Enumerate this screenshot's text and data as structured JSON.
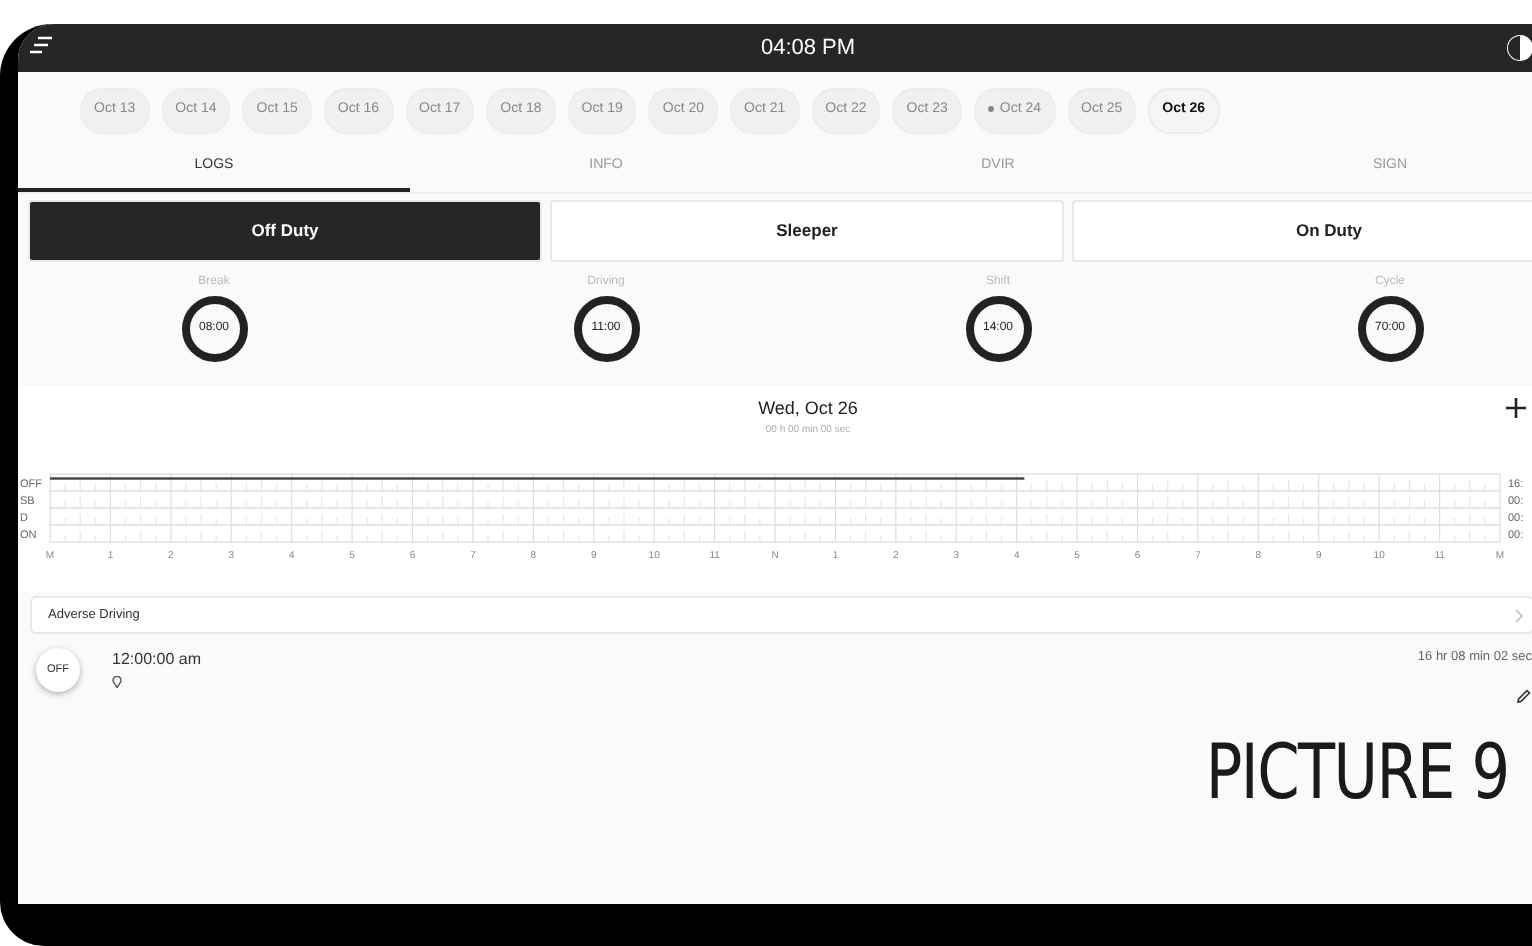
{
  "status_bar": {
    "time": "04:08 PM"
  },
  "dates": [
    {
      "label": "Oct 13",
      "selected": false,
      "dot": false
    },
    {
      "label": "Oct 14",
      "selected": false,
      "dot": false
    },
    {
      "label": "Oct 15",
      "selected": false,
      "dot": false
    },
    {
      "label": "Oct 16",
      "selected": false,
      "dot": false
    },
    {
      "label": "Oct 17",
      "selected": false,
      "dot": false
    },
    {
      "label": "Oct 18",
      "selected": false,
      "dot": false
    },
    {
      "label": "Oct 19",
      "selected": false,
      "dot": false
    },
    {
      "label": "Oct 20",
      "selected": false,
      "dot": false
    },
    {
      "label": "Oct 21",
      "selected": false,
      "dot": false
    },
    {
      "label": "Oct 22",
      "selected": false,
      "dot": false
    },
    {
      "label": "Oct 23",
      "selected": false,
      "dot": false
    },
    {
      "label": "Oct 24",
      "selected": false,
      "dot": true
    },
    {
      "label": "Oct 25",
      "selected": false,
      "dot": false
    },
    {
      "label": "Oct 26",
      "selected": true,
      "dot": false
    }
  ],
  "tabs": [
    {
      "label": "LOGS",
      "selected": true
    },
    {
      "label": "INFO",
      "selected": false
    },
    {
      "label": "DVIR",
      "selected": false
    },
    {
      "label": "SIGN",
      "selected": false
    }
  ],
  "duty_buttons": [
    {
      "label": "Off Duty",
      "selected": true
    },
    {
      "label": "Sleeper",
      "selected": false
    },
    {
      "label": "On Duty",
      "selected": false
    }
  ],
  "gauges": [
    {
      "label": "Break",
      "value": "08:00"
    },
    {
      "label": "Driving",
      "value": "11:00"
    },
    {
      "label": "Shift",
      "value": "14:00"
    },
    {
      "label": "Cycle",
      "value": "70:00"
    }
  ],
  "log_chart": {
    "title": "Wed, Oct 26",
    "subtitle": "00 h 00 min 00 sec",
    "rows": [
      {
        "label": "OFF",
        "total": "16:",
        "level": 0.672
      },
      {
        "label": "SB",
        "total": "00:"
      },
      {
        "label": "D",
        "total": "00:"
      },
      {
        "label": "ON",
        "total": "00:"
      }
    ],
    "hours": [
      "M",
      "1",
      "2",
      "3",
      "4",
      "5",
      "6",
      "7",
      "8",
      "9",
      "10",
      "11",
      "N",
      "1",
      "2",
      "3",
      "4",
      "5",
      "6",
      "7",
      "8",
      "9",
      "10",
      "11",
      "M"
    ]
  },
  "adverse_driving": {
    "label": "Adverse Driving"
  },
  "log_entries": [
    {
      "status": "OFF",
      "time": "12:00:00 am",
      "duration": "16 hr 08 min 02 sec"
    }
  ],
  "caption": "PICTURE 9"
}
